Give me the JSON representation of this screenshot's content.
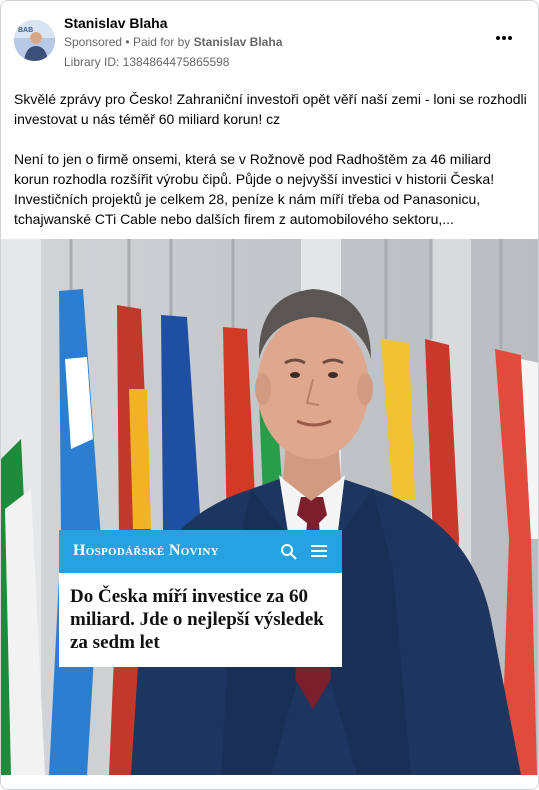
{
  "post": {
    "author": "Stanislav Blaha",
    "sponsored_label": "Sponsored",
    "paid_for_prefix": "Paid for by",
    "payer": "Stanislav Blaha",
    "library_id": "Library ID: 1384864475865598",
    "paragraph1": "Skvělé zprávy pro Česko! Zahraniční investoři opět věří naší zemi - loni se rozhodli investovat u nás téměř 60 miliard korun! cz",
    "paragraph2": "Není to jen o firmě onsemi, která se v Rožnově pod Radhoštěm za 46 miliard korun rozhodla rozšířit výrobu čipů. Půjde o nejvyšší investici v historii Česka! Investičních projektů je celkem 28, peníze k nám míří třeba od Panasonicu, tchajwanské CTi Cable nebo dalších firem z automobilového sektoru,..."
  },
  "image": {
    "news_logo": "Hospodářské Noviny",
    "headline": "Do Česka míří investice za 60 miliard. Jde o nejlepší výsledek za sedm let"
  },
  "icons": {
    "more": "more-options-icon",
    "search": "search-icon",
    "menu": "hamburger-menu-icon"
  },
  "colors": {
    "brand": "#26a2e0",
    "suit": "#1e3560",
    "tie": "#7a1f2b"
  }
}
